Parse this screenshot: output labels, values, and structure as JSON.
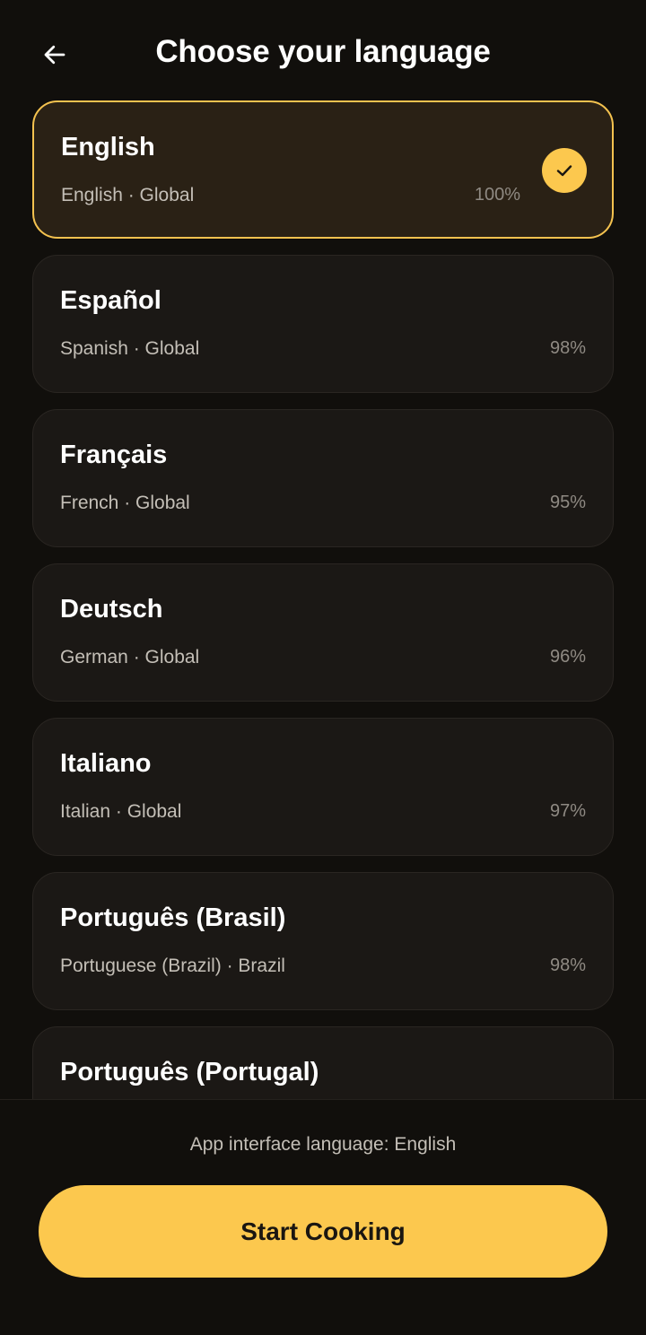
{
  "header": {
    "title": "Choose your language",
    "back_icon": "arrow-left-icon"
  },
  "languages": [
    {
      "name": "English",
      "subtitle": "English · Global",
      "percent": "100%",
      "selected": true
    },
    {
      "name": "Español",
      "subtitle": "Spanish · Global",
      "percent": "98%",
      "selected": false
    },
    {
      "name": "Français",
      "subtitle": "French · Global",
      "percent": "95%",
      "selected": false
    },
    {
      "name": "Deutsch",
      "subtitle": "German · Global",
      "percent": "96%",
      "selected": false
    },
    {
      "name": "Italiano",
      "subtitle": "Italian · Global",
      "percent": "97%",
      "selected": false
    },
    {
      "name": "Português (Brasil)",
      "subtitle": "Portuguese (Brazil) · Brazil",
      "percent": "98%",
      "selected": false
    },
    {
      "name": "Português (Portugal)",
      "subtitle": "",
      "percent": "",
      "selected": false
    }
  ],
  "footer": {
    "note": "App interface language: English",
    "start_label": "Start Cooking"
  },
  "colors": {
    "accent": "#fcc84e",
    "background": "#110f0c",
    "card": "#1b1815",
    "card_selected": "#2a2115"
  }
}
